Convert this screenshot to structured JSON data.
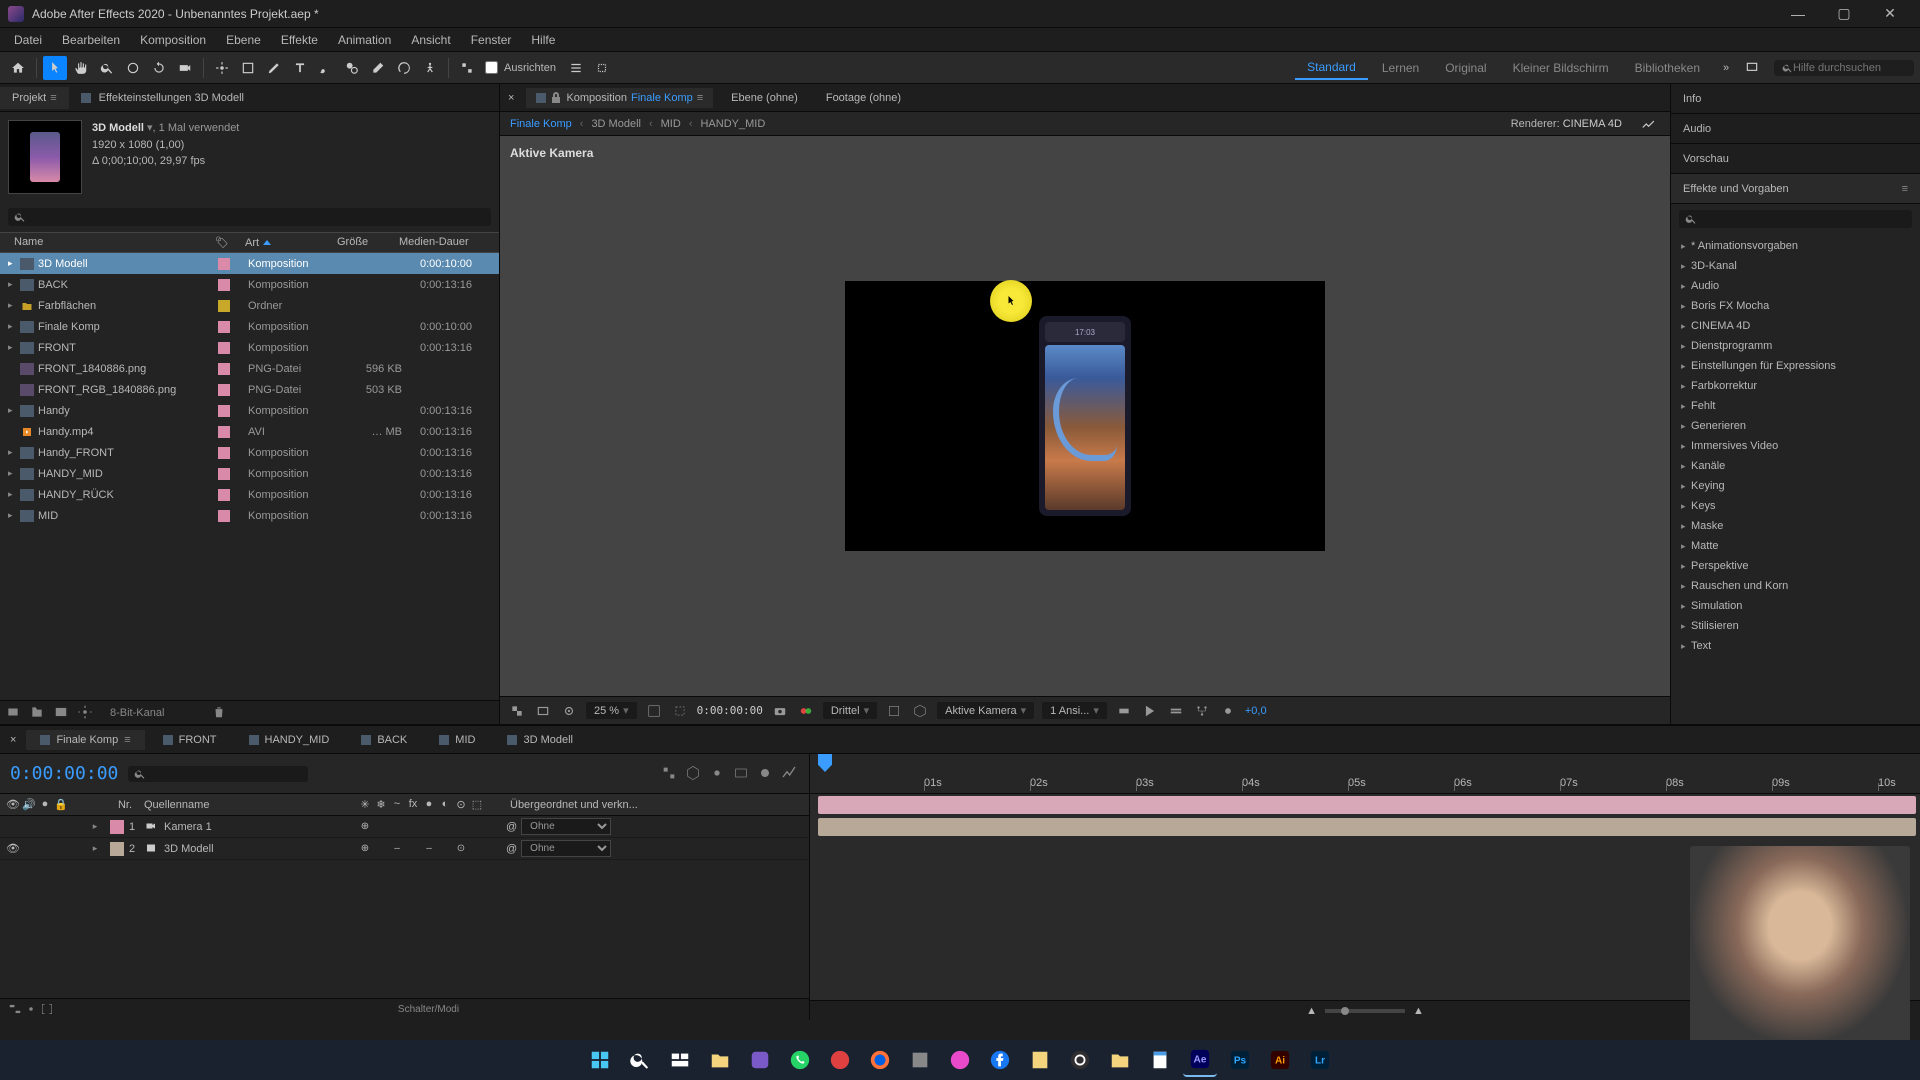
{
  "title": "Adobe After Effects 2020 - Unbenanntes Projekt.aep *",
  "menu": [
    "Datei",
    "Bearbeiten",
    "Komposition",
    "Ebene",
    "Effekte",
    "Animation",
    "Ansicht",
    "Fenster",
    "Hilfe"
  ],
  "toolbar": {
    "align_label": "Ausrichten"
  },
  "workspaces": [
    "Standard",
    "Lernen",
    "Original",
    "Kleiner Bildschirm",
    "Bibliotheken"
  ],
  "help_search_placeholder": "Hilfe durchsuchen",
  "project": {
    "tab_project": "Projekt",
    "tab_effect": "Effekteinstellungen 3D Modell",
    "sel_name": "3D Modell",
    "sel_used": ", 1 Mal verwendet",
    "sel_dim": "1920 x 1080 (1,00)",
    "sel_dur": "Δ 0;00;10;00, 29,97 fps",
    "cols": {
      "name": "Name",
      "art": "Art",
      "size": "Größe",
      "dur": "Medien-Dauer"
    },
    "items": [
      {
        "exp": "▸",
        "name": "3D Modell",
        "art": "Komposition",
        "size": "",
        "dur": "0:00:10:00",
        "lab": "pink",
        "sel": true,
        "icon": "comp"
      },
      {
        "exp": "▸",
        "name": "BACK",
        "art": "Komposition",
        "size": "",
        "dur": "0:00:13:16",
        "lab": "pink",
        "icon": "comp"
      },
      {
        "exp": "▸",
        "name": "Farbflächen",
        "art": "Ordner",
        "size": "",
        "dur": "",
        "lab": "yellow",
        "icon": "folder"
      },
      {
        "exp": "▸",
        "name": "Finale Komp",
        "art": "Komposition",
        "size": "",
        "dur": "0:00:10:00",
        "lab": "pink",
        "icon": "comp"
      },
      {
        "exp": "▸",
        "name": "FRONT",
        "art": "Komposition",
        "size": "",
        "dur": "0:00:13:16",
        "lab": "pink",
        "icon": "comp"
      },
      {
        "exp": "",
        "name": "FRONT_1840886.png",
        "art": "PNG-Datei",
        "size": "596 KB",
        "dur": "",
        "lab": "pink",
        "icon": "img"
      },
      {
        "exp": "",
        "name": "FRONT_RGB_1840886.png",
        "art": "PNG-Datei",
        "size": "503 KB",
        "dur": "",
        "lab": "pink",
        "icon": "img"
      },
      {
        "exp": "▸",
        "name": "Handy",
        "art": "Komposition",
        "size": "",
        "dur": "0:00:13:16",
        "lab": "pink",
        "icon": "comp"
      },
      {
        "exp": "",
        "name": "Handy.mp4",
        "art": "AVI",
        "size": "… MB",
        "dur": "0:00:13:16",
        "lab": "pink",
        "icon": "vid"
      },
      {
        "exp": "▸",
        "name": "Handy_FRONT",
        "art": "Komposition",
        "size": "",
        "dur": "0:00:13:16",
        "lab": "pink",
        "icon": "comp"
      },
      {
        "exp": "▸",
        "name": "HANDY_MID",
        "art": "Komposition",
        "size": "",
        "dur": "0:00:13:16",
        "lab": "pink",
        "icon": "comp"
      },
      {
        "exp": "▸",
        "name": "HANDY_RÜCK",
        "art": "Komposition",
        "size": "",
        "dur": "0:00:13:16",
        "lab": "pink",
        "icon": "comp"
      },
      {
        "exp": "▸",
        "name": "MID",
        "art": "Komposition",
        "size": "",
        "dur": "0:00:13:16",
        "lab": "pink",
        "icon": "comp"
      }
    ],
    "footer_bpc": "8-Bit-Kanal"
  },
  "comp": {
    "tab_comp": "Komposition",
    "tab_comp_name": "Finale Komp",
    "tab_layer": "Ebene  (ohne)",
    "tab_footage": "Footage  (ohne)",
    "breadcrumb": [
      "Finale Komp",
      "3D Modell",
      "MID",
      "HANDY_MID"
    ],
    "renderer_label": "Renderer:",
    "renderer": "CINEMA 4D",
    "view_label": "Aktive Kamera",
    "phone_time": "17:03",
    "zoom": "25 %",
    "timecode": "0:00:00:00",
    "res": "Drittel",
    "cam": "Aktive Kamera",
    "views": "1 Ansi...",
    "exposure": "+0,0"
  },
  "right": {
    "info": "Info",
    "audio": "Audio",
    "preview": "Vorschau",
    "effects": "Effekte und Vorgaben",
    "cats": [
      "* Animationsvorgaben",
      "3D-Kanal",
      "Audio",
      "Boris FX Mocha",
      "CINEMA 4D",
      "Dienstprogramm",
      "Einstellungen für Expressions",
      "Farbkorrektur",
      "Fehlt",
      "Generieren",
      "Immersives Video",
      "Kanäle",
      "Keying",
      "Keys",
      "Maske",
      "Matte",
      "Perspektive",
      "Rauschen und Korn",
      "Simulation",
      "Stilisieren",
      "Text"
    ]
  },
  "timeline": {
    "tabs": [
      "Finale Komp",
      "FRONT",
      "HANDY_MID",
      "BACK",
      "MID",
      "3D Modell"
    ],
    "time": "0:00:00:00",
    "cols": {
      "nr": "Nr.",
      "name": "Quellenname",
      "parent": "Übergeordnet und verkn..."
    },
    "layers": [
      {
        "nr": "1",
        "name": "Kamera 1",
        "parent": "Ohne",
        "lab": "#d88aa8",
        "icon": "cam",
        "eye": false
      },
      {
        "nr": "2",
        "name": "3D Modell",
        "parent": "Ohne",
        "lab": "#b8a898",
        "icon": "comp",
        "eye": true
      }
    ],
    "ticks": [
      "01s",
      "02s",
      "03s",
      "04s",
      "05s",
      "06s",
      "07s",
      "08s",
      "09s",
      "10s"
    ],
    "footer": "Schalter/Modi"
  }
}
